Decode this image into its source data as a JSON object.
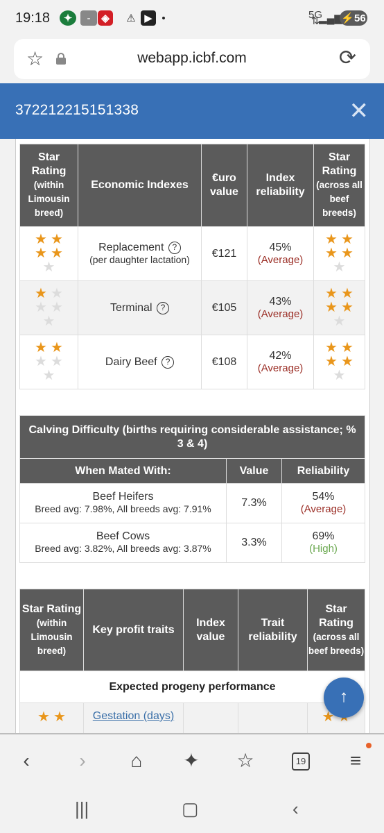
{
  "status_bar": {
    "time": "19:18",
    "network": "5G",
    "battery": "56"
  },
  "browser": {
    "url": "webapp.icbf.com",
    "tab_count": "19"
  },
  "sheet": {
    "title": "372212215151338"
  },
  "economic_table": {
    "headers": {
      "star_within": "Star Rating (within Limousin breed)",
      "index_name": "Economic Indexes",
      "euro_value": "€uro value",
      "reliability": "Index reliability",
      "star_across": "Star Rating (across all beef breeds)"
    },
    "rows": [
      {
        "name": "Replacement",
        "sub": "(per daughter lactation)",
        "value": "€121",
        "reliability": "45%",
        "rel_label": "(Average)",
        "stars_within": 4,
        "stars_across": 4
      },
      {
        "name": "Terminal",
        "sub": "",
        "value": "€105",
        "reliability": "43%",
        "rel_label": "(Average)",
        "stars_within": 1,
        "stars_across": 4
      },
      {
        "name": "Dairy Beef",
        "sub": "",
        "value": "€108",
        "reliability": "42%",
        "rel_label": "(Average)",
        "stars_within": 2,
        "stars_across": 4
      }
    ]
  },
  "calving_table": {
    "caption": "Calving Difficulty (births requiring considerable assistance; % 3 & 4)",
    "headers": {
      "mated_with": "When Mated With:",
      "value": "Value",
      "reliability": "Reliability"
    },
    "rows": [
      {
        "name": "Beef Heifers",
        "avg": "Breed avg: 7.98%, All breeds avg: 7.91%",
        "value": "7.3%",
        "reliability": "54%",
        "rel_label": "(Average)"
      },
      {
        "name": "Beef Cows",
        "avg": "Breed avg: 3.82%, All breeds avg: 3.87%",
        "value": "3.3%",
        "reliability": "69%",
        "rel_label": "(High)"
      }
    ]
  },
  "profit_table": {
    "headers": {
      "star_within": "Star Rating (within Limousin breed)",
      "traits": "Key profit traits",
      "index_value": "Index value",
      "reliability": "Trait reliability",
      "star_across": "Star Rating (across all beef breeds)"
    },
    "progeny_label": "Expected progeny performance",
    "first_trait": {
      "name": "Gestation (days)"
    }
  },
  "icons": {
    "status": [
      "sport-club-icon",
      "app-icon",
      "football-club-icon",
      "warning-icon",
      "youtube-icon"
    ],
    "toolbar": [
      "back-icon",
      "forward-icon",
      "home-icon",
      "ai-sparkle-icon",
      "bookmarks-icon",
      "tabs-icon",
      "menu-icon"
    ]
  },
  "colors": {
    "header_blue": "#3870b6",
    "table_header": "#5b5b5b",
    "star": "#e9961b",
    "average": "#9b2e26",
    "high": "#6aa84f"
  }
}
